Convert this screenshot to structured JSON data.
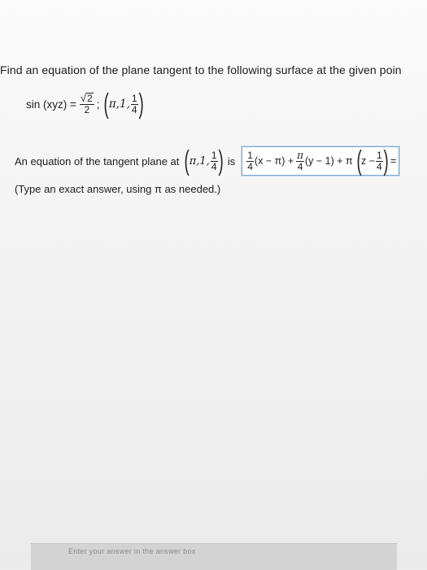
{
  "question": {
    "prompt": "Find an equation of the plane tangent to the following surface at the given poin"
  },
  "surface": {
    "lhs": "sin (xyz) =",
    "rhs_sqrt_arg": "2",
    "rhs_den": "2",
    "separator": ";",
    "point_prefix": "π,1,",
    "point_frac_num": "1",
    "point_frac_den": "4"
  },
  "statement": {
    "lead": "An equation of the tangent plane at",
    "point_prefix": "π,1,",
    "point_frac_num": "1",
    "point_frac_den": "4",
    "is_word": "is"
  },
  "answer": {
    "coef1_num": "1",
    "coef1_den": "4",
    "term1": "(x − π) +",
    "coef2_num": "π",
    "coef2_den": "4",
    "term2": "(y − 1) + π",
    "term3_prefix": "z −",
    "term3_frac_num": "1",
    "term3_frac_den": "4",
    "tail": "="
  },
  "hint": "(Type an exact answer, using π as needed.)",
  "footer": {
    "instruction": "Enter your answer in the answer box"
  }
}
